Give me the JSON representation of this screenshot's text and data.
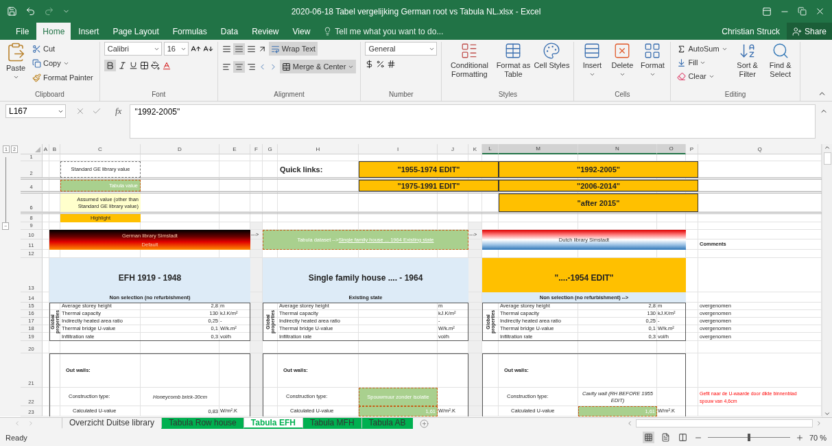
{
  "window": {
    "title": "2020-06-18 Tabel vergelijking German root vs Tabula NL.xlsx - Excel"
  },
  "ribbon_tabs": [
    {
      "label": "File",
      "selected": false
    },
    {
      "label": "Home",
      "selected": true
    },
    {
      "label": "Insert",
      "selected": false
    },
    {
      "label": "Page Layout",
      "selected": false
    },
    {
      "label": "Formulas",
      "selected": false
    },
    {
      "label": "Data",
      "selected": false
    },
    {
      "label": "Review",
      "selected": false
    },
    {
      "label": "View",
      "selected": false
    }
  ],
  "tell_me": "Tell me what you want to do...",
  "user": "Christian Struck",
  "share": "Share",
  "ribbon": {
    "clipboard": {
      "paste": "Paste",
      "cut": "Cut",
      "copy": "Copy",
      "format_painter": "Format Painter",
      "label": "Clipboard"
    },
    "font": {
      "name": "Calibri",
      "size": "16",
      "label": "Font"
    },
    "alignment": {
      "wrap_text": "Wrap Text",
      "merge": "Merge & Center",
      "label": "Alignment"
    },
    "number": {
      "format": "General",
      "label": "Number"
    },
    "styles": {
      "commands": [
        "Conditional Formatting",
        "Format as Table",
        "Cell Styles"
      ],
      "label": "Styles"
    },
    "cells": {
      "commands": [
        "Insert",
        "Delete",
        "Format"
      ],
      "label": "Cells"
    },
    "editing": {
      "autosum": "AutoSum",
      "fill": "Fill",
      "clear": "Clear",
      "commands": [
        "Sort & Filter",
        "Find & Select"
      ],
      "label": "Editing"
    }
  },
  "formula_bar": {
    "name_box": "L167",
    "fx": "fx",
    "value": "\"1992-2005\""
  },
  "outline": {
    "levels": [
      "1",
      "2"
    ],
    "collapse": "−"
  },
  "columns": [
    {
      "label": "A",
      "selected": false
    },
    {
      "label": "B",
      "selected": false
    },
    {
      "label": "C",
      "selected": false
    },
    {
      "label": "D",
      "selected": false
    },
    {
      "label": "E",
      "selected": false
    },
    {
      "label": "F",
      "selected": false
    },
    {
      "label": "G",
      "selected": false
    },
    {
      "label": "H",
      "selected": false
    },
    {
      "label": "I",
      "selected": false
    },
    {
      "label": "J",
      "selected": false
    },
    {
      "label": "K",
      "selected": false
    },
    {
      "label": "L",
      "selected": true
    },
    {
      "label": "M",
      "selected": true
    },
    {
      "label": "N",
      "selected": true
    },
    {
      "label": "O",
      "selected": true
    },
    {
      "label": "P",
      "selected": false
    },
    {
      "label": "Q",
      "selected": false
    }
  ],
  "row_numbers": [
    "1",
    "2",
    "4",
    "6",
    "8",
    "9",
    "10",
    "11",
    "12",
    "13",
    "14",
    "15",
    "16",
    "17",
    "18",
    "19",
    "20",
    "21",
    "22",
    "23"
  ],
  "legend": [
    {
      "kind": "standard",
      "text": "Standard GE library value"
    },
    {
      "kind": "tabula",
      "text": "Tabula value"
    },
    {
      "kind": "assumed",
      "text": "Assumed value (other than Standard GE library value)"
    },
    {
      "kind": "highlight",
      "text": "Highlight"
    }
  ],
  "quick_links": {
    "label": "Quick links:",
    "links": [
      "\"1955-1974 EDIT\"",
      "\"1992-2005\"",
      "\"1975-1991 EDIT\"",
      "\"2006-2014\"",
      "\"after 2015\""
    ]
  },
  "arrows": [
    "--->",
    "--->"
  ],
  "sections": [
    {
      "banner": {
        "kind": "german",
        "lines": [
          "German  library Simstadt",
          "Default"
        ]
      },
      "title": {
        "text": "EFH 1919 - 1948",
        "highlighted": false
      },
      "subheader": "Non selection (no refurbishment)",
      "group_label": "Global properties",
      "properties": [
        {
          "label": "Average storey height",
          "value": "2,8",
          "unit": "m"
        },
        {
          "label": "Thermal capacity",
          "value": "130",
          "unit": "kJ.K/m²"
        },
        {
          "label": "Indirectly heated area ratio",
          "value": "0,25",
          "unit": "-"
        },
        {
          "label": "Thermal bridge U-value",
          "value": "0,1",
          "unit": "W/k.m²"
        },
        {
          "label": "Infiltration rate",
          "value": "0,3",
          "unit": "vol/h"
        }
      ],
      "walls": {
        "heading": "Out walls:",
        "construction_label": "Construction type:",
        "construction": {
          "text": "Honeycomb brick-30cm",
          "kind": "italic"
        },
        "u_label": "Calculated U-value",
        "u_value": {
          "text": "0,83",
          "kind": "plain"
        },
        "u_unit": "W/m².K"
      }
    },
    {
      "banner": {
        "kind": "tabula",
        "lines": [
          "Tabula dataset --> "
        ],
        "link": "Single family house ... 1964 Existing state"
      },
      "title": {
        "text": "Single family house .... - 1964",
        "highlighted": false
      },
      "subheader": "Existing state",
      "group_label": "Global properties",
      "properties": [
        {
          "label": "Average storey height",
          "unit": "m"
        },
        {
          "label": "Thermal capacity",
          "unit": "kJ.K/m²"
        },
        {
          "label": "Indirectly heated area ratio",
          "unit": "-"
        },
        {
          "label": "Thermal bridge U-value",
          "unit": "W/k.m²"
        },
        {
          "label": "Infiltration rate",
          "unit": "vol/h"
        }
      ],
      "walls": {
        "heading": "Out walls:",
        "construction_label": "Construction type:",
        "construction": {
          "text": "Spouwmuur zonder isolatie",
          "kind": "tabula"
        },
        "u_label": "Calculated U-value",
        "u_value": {
          "text": "1,61",
          "kind": "tabula"
        },
        "u_unit": "W/m².K"
      }
    },
    {
      "banner": {
        "kind": "dutch",
        "lines": [
          "Dutch library Simstadt"
        ]
      },
      "title": {
        "text": "\"....-1954 EDIT\"",
        "highlighted": true
      },
      "subheader": "Non selection (no refurbishment) -->",
      "group_label": "Global properties",
      "properties": [
        {
          "label": "Average storey height",
          "value": "2,8",
          "unit": "m"
        },
        {
          "label": "Thermal capacity",
          "value": "130",
          "unit": "kJ.K/m²"
        },
        {
          "label": "Indirectly heated area ratio",
          "value": "0,25",
          "unit": "-"
        },
        {
          "label": "Thermal bridge U-value",
          "value": "0,1",
          "unit": "W/k.m²"
        },
        {
          "label": "Infiltration rate",
          "value": "0,3",
          "unit": "vol/h"
        }
      ],
      "walls": {
        "heading": "Out walls:",
        "construction_label": "Construction type:",
        "construction": {
          "text": "Cavity wall (RH BEFORE 1955 EDIT)",
          "kind": "italic"
        },
        "u_label": "Calculated U-value",
        "u_value": {
          "text": "1,61",
          "kind": "tabula"
        },
        "u_unit": "W/m².K"
      }
    }
  ],
  "comments": {
    "header": "Comments",
    "items": [
      "overgenomen",
      "overgenomen",
      "overgenomen",
      "overgenomen",
      "overgenomen"
    ],
    "note": [
      "Gefit naar de U-waarde door dikte binnenblad",
      "spouw van 4,6cm"
    ]
  },
  "sheet_tabs": [
    {
      "label": "Overzicht Duitse library",
      "selected": false
    },
    {
      "label": "Tabula Row house",
      "selected": false,
      "color": "#00b050"
    },
    {
      "label": "Tabula EFH",
      "selected": true,
      "color": "#00b050"
    },
    {
      "label": "Tabula MFH",
      "selected": false,
      "color": "#00b050"
    },
    {
      "label": "Tabula AB",
      "selected": false,
      "color": "#00b050"
    }
  ],
  "status": {
    "text": "Ready",
    "zoom": "70 %",
    "level": 0.5
  }
}
